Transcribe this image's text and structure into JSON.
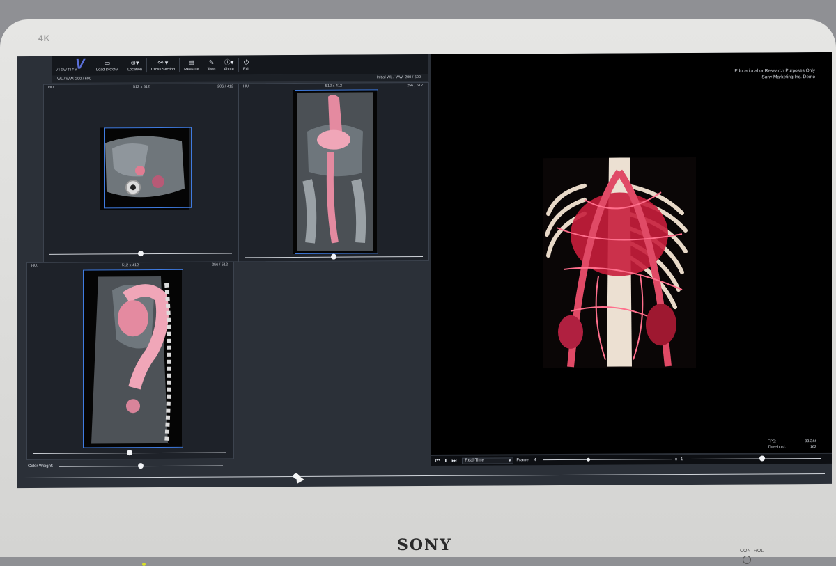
{
  "monitor": {
    "badge": "4K",
    "brand": "SONY",
    "control_label": "CONTROL"
  },
  "toolbar": {
    "logo_text": "VIEWTIFY",
    "logo_letter": "V",
    "buttons": [
      {
        "label": "Load DICOM",
        "icon": "folder-icon"
      },
      {
        "label": "Location",
        "icon": "location-icon"
      },
      {
        "label": "Cross Section",
        "icon": "cross-section-icon"
      },
      {
        "label": "Measure",
        "icon": "ruler-icon"
      },
      {
        "label": "Toon",
        "icon": "toon-icon"
      },
      {
        "label": "About",
        "icon": "info-icon"
      },
      {
        "label": "Exit",
        "icon": "power-icon"
      }
    ]
  },
  "wl_bar": {
    "left_label": "WL / WW:",
    "left_value": "200 / 600",
    "right_label": "Initial WL / WW:",
    "right_value": "200 / 600"
  },
  "viewports": [
    {
      "hu": "HU:",
      "size": "512 x 512",
      "slice": "206 / 412",
      "slider_value": 0.5
    },
    {
      "hu": "HU:",
      "size": "512 x 412",
      "slice": "256 / 512",
      "slider_value": 0.5
    },
    {
      "hu": "HU:",
      "size": "512 x 412",
      "slice": "256 / 512",
      "slider_value": 0.5
    }
  ],
  "render_view": {
    "disclaimer_line1": "Educational or Research Purposes Only",
    "disclaimer_line2": "Sony Marketing Inc. Demo",
    "fps_label": "FPS:",
    "fps_value": "83.344",
    "threshold_label": "Threshold:",
    "threshold_value": "162"
  },
  "playback": {
    "mode": "Real-Time",
    "frame_label": "Frame:",
    "frame_value": "4",
    "speed_label": "x",
    "speed_value": "1",
    "frame_slider_value": 0.35,
    "threshold_slider_value": 0.55
  },
  "color_weight": {
    "label": "Color Weight:",
    "value": 0.5
  },
  "main_slider_value": 0.34,
  "colors": {
    "accent_blue": "#3f7be0",
    "vessel_red": "#d63a55",
    "background": "#2b3038"
  }
}
